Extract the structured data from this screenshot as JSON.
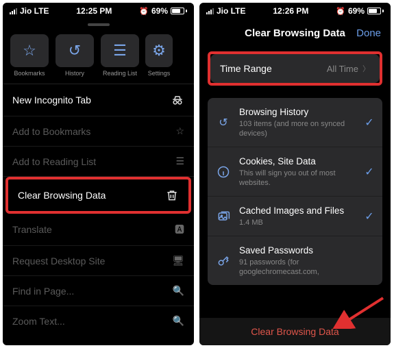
{
  "left": {
    "status": {
      "carrier": "Jio  LTE",
      "time": "12:25 PM",
      "battery": "69%"
    },
    "toolbar": [
      {
        "label": "Bookmarks"
      },
      {
        "label": "History"
      },
      {
        "label": "Reading List"
      },
      {
        "label": "Settings"
      }
    ],
    "incognito": "New Incognito Tab",
    "menu": {
      "add_bookmarks": "Add to Bookmarks",
      "add_reading": "Add to Reading List",
      "clear_data": "Clear Browsing Data",
      "translate": "Translate",
      "request_desktop": "Request Desktop Site",
      "find_in_page": "Find in Page...",
      "zoom_text": "Zoom Text..."
    }
  },
  "right": {
    "status": {
      "carrier": "Jio  LTE",
      "time": "12:26 PM",
      "battery": "69%"
    },
    "header": {
      "title": "Clear Browsing Data",
      "done": "Done"
    },
    "time_range": {
      "label": "Time Range",
      "value": "All Time"
    },
    "items": [
      {
        "title": "Browsing History",
        "sub": "103 items (and more on synced devices)",
        "checked": true
      },
      {
        "title": "Cookies, Site Data",
        "sub": "This will sign you out of most websites.",
        "checked": true
      },
      {
        "title": "Cached Images and Files",
        "sub": "1.4 MB",
        "checked": true
      },
      {
        "title": "Saved Passwords",
        "sub": "91 passwords (for googlechromecast.com,",
        "checked": false
      }
    ],
    "bottom_action": "Clear Browsing Data"
  }
}
